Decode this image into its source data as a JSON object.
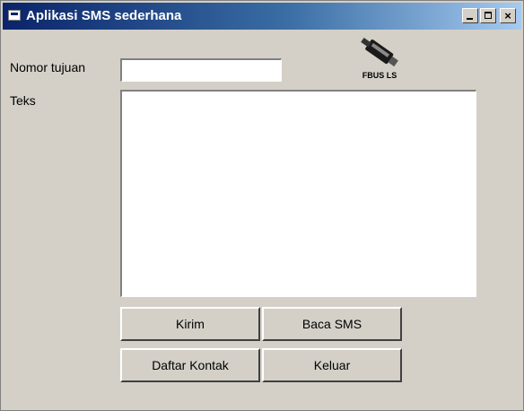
{
  "window": {
    "title": "Aplikasi SMS sederhana",
    "title_buttons": {
      "minimize": "minimize",
      "maximize": "maximize",
      "close": "×"
    }
  },
  "form": {
    "nomor_label": "Nomor tujuan",
    "nomor_value": "",
    "teks_label": "Teks",
    "teks_value": ""
  },
  "logo": {
    "text": "FBUS LS",
    "icon": "cable-connector-icon"
  },
  "buttons": {
    "kirim": "Kirim",
    "baca_sms": "Baca SMS",
    "daftar_kontak": "Daftar Kontak",
    "keluar": "Keluar"
  },
  "colors": {
    "titlebar_start": "#0a246a",
    "titlebar_end": "#a6caf0",
    "face": "#d4d0c8"
  }
}
